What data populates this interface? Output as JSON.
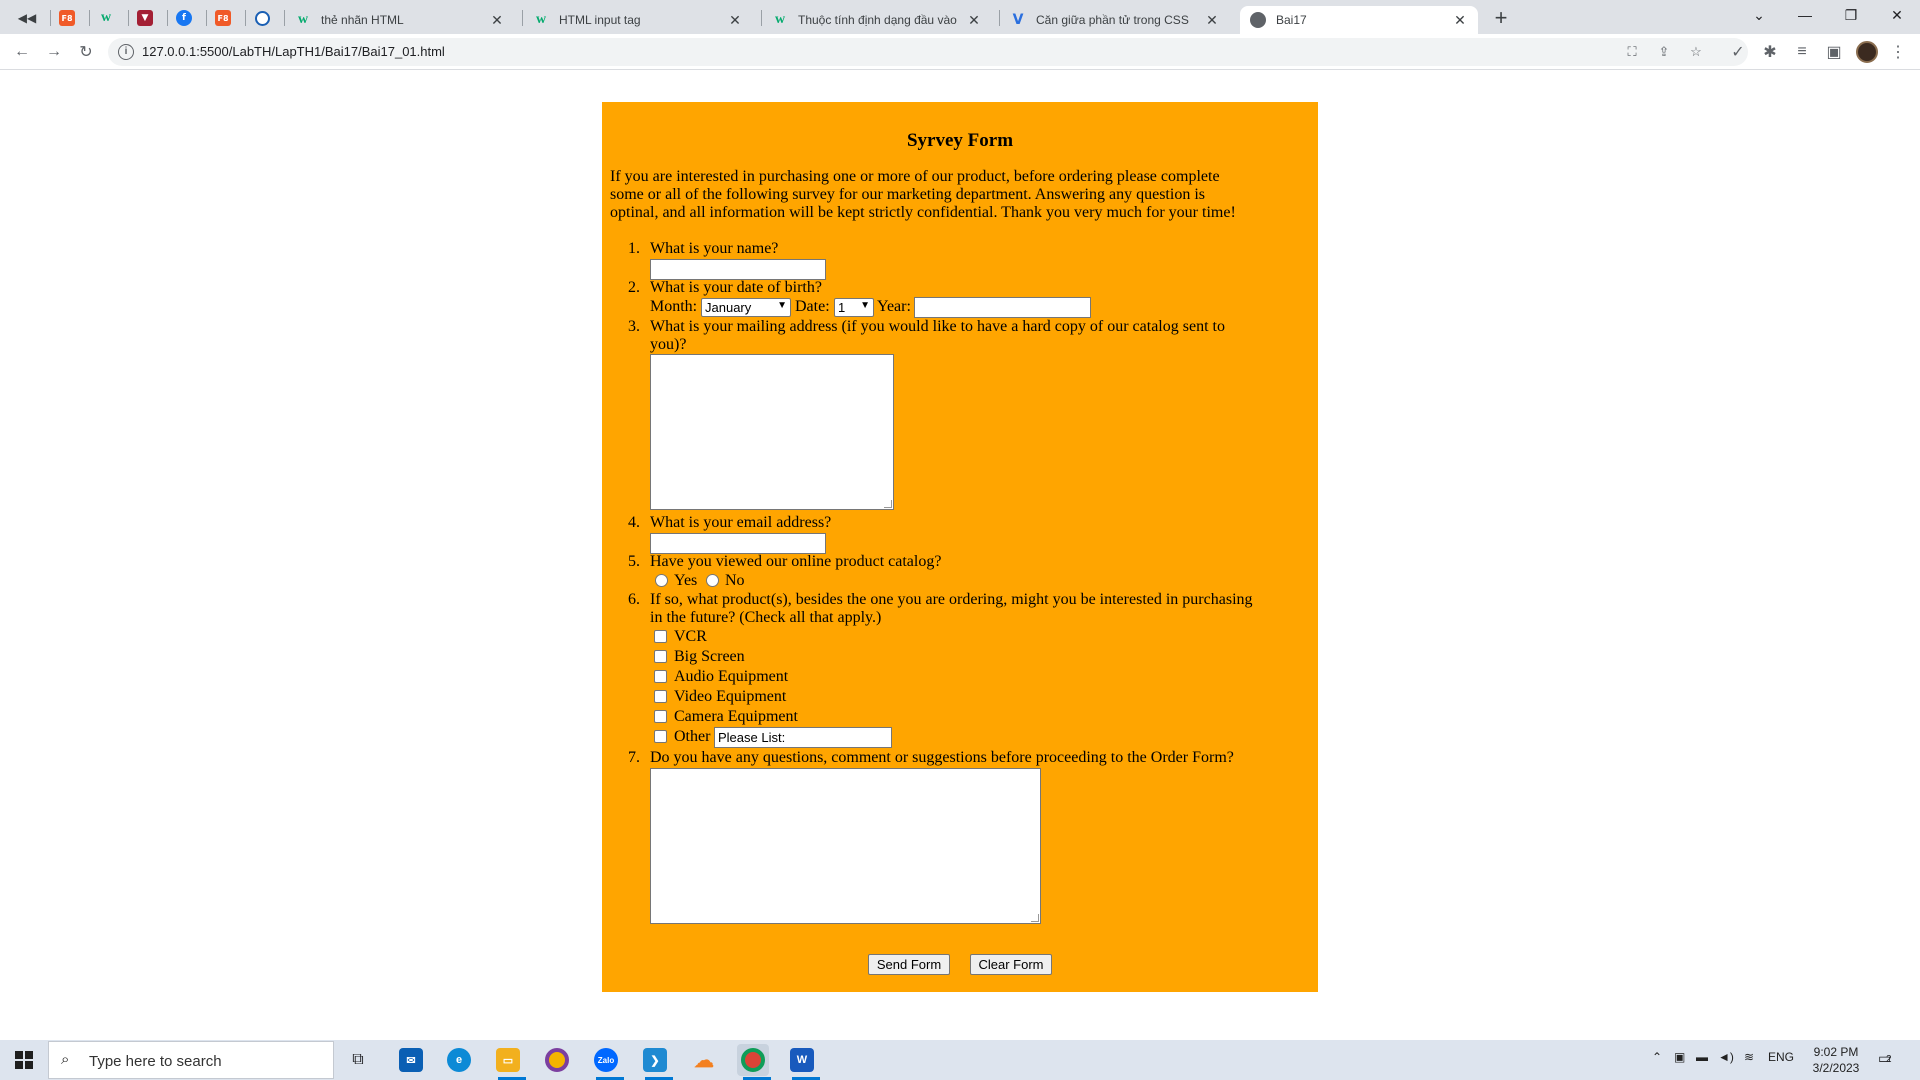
{
  "browser": {
    "tabs": [
      {
        "icon": "back-audio-icon",
        "title": ""
      },
      {
        "icon": "f8-icon",
        "title": ""
      },
      {
        "icon": "w3schools-icon",
        "title": ""
      },
      {
        "icon": "shield-icon",
        "title": ""
      },
      {
        "icon": "facebook-icon",
        "title": ""
      },
      {
        "icon": "f8-icon",
        "title": ""
      },
      {
        "icon": "globe-icon",
        "title": ""
      },
      {
        "icon": "w3schools-icon",
        "title": "thẻ nhãn HTML"
      },
      {
        "icon": "w3schools-icon",
        "title": "HTML input tag"
      },
      {
        "icon": "w3schools-icon",
        "title": "Thuộc tính định dạng đầu vào HT"
      },
      {
        "icon": "vietjack-icon",
        "title": "Căn giữa phần tử trong CSS"
      },
      {
        "icon": "web-icon",
        "title": "Bai17"
      }
    ],
    "active_tab_index": 11,
    "url": "127.0.0.1:5500/LabTH/LapTH1/Bai17/Bai17_01.html"
  },
  "form": {
    "title": "Syrvey Form",
    "intro": "If you are interested in purchasing one or more of our product, before ordering please complete some or all of the following survey for our marketing department. Answering any question is optinal, and all information will be kept strictly confidential. Thank you very much for your time!",
    "q1": {
      "num": "1.",
      "text": "What is your name?",
      "value": ""
    },
    "q2": {
      "num": "2.",
      "text": "What is your date of birth?",
      "month_label": "Month:",
      "month_value": "January",
      "date_label": "Date:",
      "date_value": "1",
      "year_label": "Year:",
      "year_value": ""
    },
    "q3": {
      "num": "3.",
      "text_line1": "What is your mailing address (if you would like to have a hard copy of our catalog sent to",
      "text_line2": "you)?",
      "value": ""
    },
    "q4": {
      "num": "4.",
      "text": "What is your email address?",
      "value": ""
    },
    "q5": {
      "num": "5.",
      "text": "Have you viewed our online product catalog?",
      "yes": "Yes",
      "no": "No"
    },
    "q6": {
      "num": "6.",
      "text_line1": "If so, what product(s), besides the one you are ordering, might you be interested in purchasing",
      "text_line2": "in the future? (Check all that apply.)",
      "options": [
        "VCR",
        "Big Screen",
        "Audio Equipment",
        "Video Equipment",
        "Camera Equipment",
        "Other"
      ],
      "other_value": "Please List:"
    },
    "q7": {
      "num": "7.",
      "text": "Do you have any questions, comment or suggestions before proceeding to the Order Form?",
      "value": ""
    },
    "send_label": "Send Form",
    "clear_label": "Clear Form",
    "background_color": "#ffa500"
  },
  "taskbar": {
    "search_placeholder": "Type here to search",
    "apps": [
      "task-view-icon",
      "mail-icon",
      "edge-icon",
      "file-explorer-icon",
      "chrome-canary-icon",
      "zalo-icon",
      "vscode-icon",
      "cloud-icon",
      "chrome-icon",
      "word-icon"
    ],
    "language": "ENG",
    "time": "9:02 PM",
    "date": "3/2/2023",
    "notification_count": "2"
  }
}
